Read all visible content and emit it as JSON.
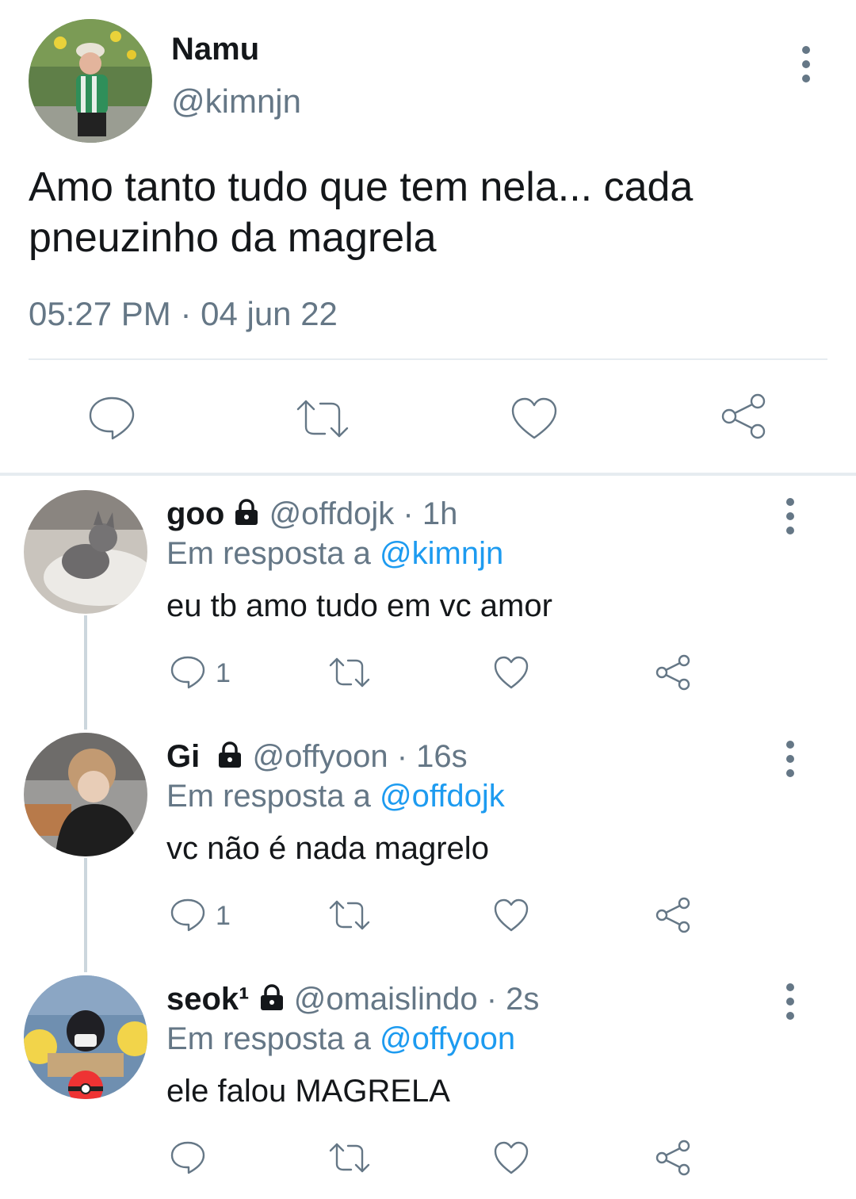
{
  "tweet": {
    "name": "Namu",
    "handle": "@kimnjn",
    "text_line1": "Amo tanto tudo que tem nela... cada",
    "text_line2": "pneuzinho da magrela",
    "timestamp": "05:27 PM · 04 jun 22",
    "icons": [
      "reply-icon",
      "retweet-icon",
      "like-icon",
      "share-icon",
      "more-icon"
    ]
  },
  "replies": [
    {
      "name": "goo",
      "handle": "@offdojk",
      "time": "1h",
      "in_reply_label": "Em resposta a",
      "in_reply_to": "@kimnjn",
      "text": "eu tb amo tudo em vc amor",
      "reply_count": "1"
    },
    {
      "name": "Gi",
      "handle": "@offyoon",
      "time": "16s",
      "in_reply_label": "Em resposta a",
      "in_reply_to": "@offdojk",
      "text": "vc não é nada magrelo",
      "reply_count": "1"
    },
    {
      "name": "seok¹",
      "handle": "@omaislindo",
      "time": "2s",
      "in_reply_label": "Em resposta a",
      "in_reply_to": "@offyoon",
      "text": "ele falou MAGRELA",
      "reply_count": ""
    }
  ],
  "separator": "·",
  "colors": {
    "text": "#14171a",
    "secondary": "#657786",
    "link": "#1d9bf0",
    "divider": "#e6ecf0"
  }
}
